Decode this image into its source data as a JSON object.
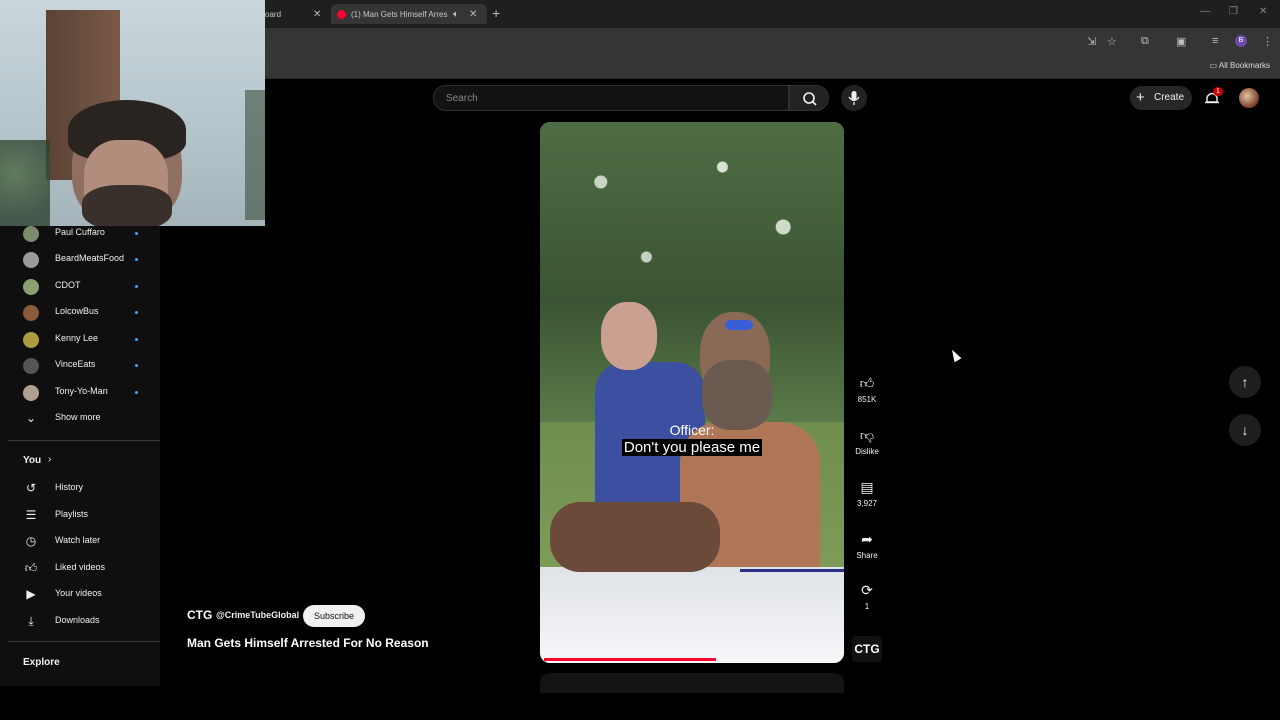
{
  "browser": {
    "tabs": [
      {
        "title": "oard"
      },
      {
        "title": "(1) Man Gets Himself Arres"
      }
    ],
    "bookmarks_label": "All Bookmarks",
    "profile_initial": "B"
  },
  "search": {
    "placeholder": "Search"
  },
  "header": {
    "create_label": "Create",
    "notification_count": "1"
  },
  "sidebar": {
    "subscriptions": [
      {
        "label": "Paul Cuffaro",
        "color": "#7a8a6a"
      },
      {
        "label": "BeardMeatsFood",
        "color": "#9a9a9a"
      },
      {
        "label": "CDOT",
        "color": "#8aa070"
      },
      {
        "label": "LolcowBus",
        "color": "#8a5a3a"
      },
      {
        "label": "Kenny Lee",
        "color": "#b09a40"
      },
      {
        "label": "VinceEats",
        "color": "#555555"
      },
      {
        "label": "Tony-Yo-Man",
        "color": "#b0a090"
      }
    ],
    "show_more": "Show more",
    "you_label": "You",
    "you_items": [
      {
        "label": "History"
      },
      {
        "label": "Playlists"
      },
      {
        "label": "Watch later"
      },
      {
        "label": "Liked videos"
      },
      {
        "label": "Your videos"
      },
      {
        "label": "Downloads"
      }
    ],
    "explore_label": "Explore"
  },
  "video": {
    "caption_speaker": "Officer:",
    "caption_text": "Don't you please me",
    "progress": 0.58
  },
  "actions": {
    "likes": "851K",
    "dislike_label": "Dislike",
    "comments": "3,927",
    "share_label": "Share",
    "remix_count": "1",
    "channel_thumb": "CTG"
  },
  "channel": {
    "name": "CTG",
    "handle": "@CrimeTubeGlobal",
    "subscribe_label": "Subscribe",
    "title": "Man Gets Himself Arrested For No Reason"
  }
}
